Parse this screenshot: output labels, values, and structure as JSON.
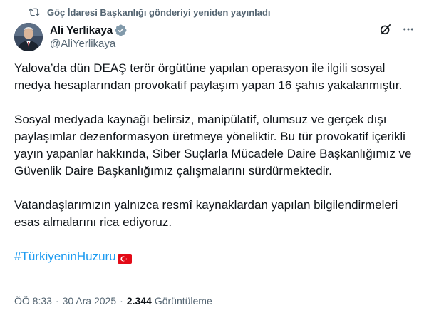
{
  "retweet": {
    "label": "Göç İdaresi Başkanlığı gönderiyi yeniden yayınladı"
  },
  "author": {
    "display_name": "Ali Yerlikaya",
    "handle": "@AliYerlikaya",
    "verified": true
  },
  "actions": {
    "grok_icon": "grok-icon",
    "more_icon": "more-icon"
  },
  "tweet": {
    "paragraphs": [
      "Yalova’da dün DEAŞ terör örgütüne yapılan operasyon ile ilgili sosyal medya hesaplarından provokatif paylaşım yapan 16 şahıs yakalanmıştır.",
      "Sosyal medyada kaynağı belirsiz, manipülatif, olumsuz ve gerçek dışı paylaşımlar dezenformasyon üretmeye yöneliktir. Bu tür provokatif içerikli yayın yapanlar hakkında, Siber Suçlarla Mücadele Daire Başkanlığımız ve Güvenlik Daire Başkanlığımız çalışmalarını sürdürmektedir.",
      "Vatandaşlarımızın yalnızca resmî kaynaklardan yapılan bilgilendirmeleri esas almalarını rica ediyoruz."
    ],
    "hashtag": "#TürkiyeninHuzuru",
    "flag_emoji": "turkey-flag"
  },
  "meta": {
    "time": "ÖÖ 8:33",
    "separator": "·",
    "date": "30 Ara 2025",
    "views_count": "2.344",
    "views_label": "Görüntüleme"
  },
  "colors": {
    "text": "#0f1419",
    "secondary": "#536471",
    "link": "#1d9bf0",
    "verified": "#829aab",
    "flag_red": "#e30a17"
  }
}
